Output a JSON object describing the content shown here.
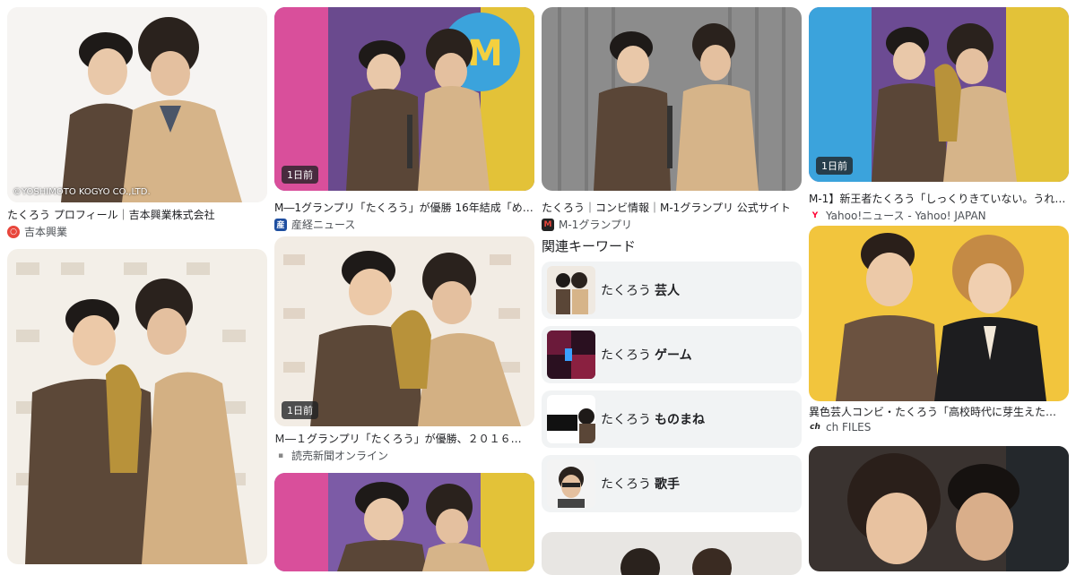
{
  "column1": {
    "card1": {
      "credit": "©YOSHIMOTO KOGYO CO.,LTD.",
      "title": "たくろう プロフィール｜吉本興業株式会社",
      "source": "吉本興業",
      "source_color": "#e8463c"
    }
  },
  "column2": {
    "card1": {
      "badge": "1日前",
      "title": "M―1グランプリ「たくろう」が優勝 16年結成「め…",
      "source": "産経ニュース",
      "source_color": "#1f4fa0"
    },
    "card2": {
      "badge": "1日前",
      "title": "Ｍ―１グランプリ「たくろう」が優勝、２０１６…",
      "source": "読売新聞オンライン",
      "source_color": "#888888"
    }
  },
  "column3": {
    "card1": {
      "title": "たくろう｜コンビ情報｜M-1グランプリ 公式サイト",
      "source": "M-1グランプリ",
      "source_color": "#c4161c"
    },
    "keywords_heading": "関連キーワード",
    "keywords": [
      {
        "prefix": "たくろう",
        "term": "芸人"
      },
      {
        "prefix": "たくろう",
        "term": "ゲーム"
      },
      {
        "prefix": "たくろう",
        "term": "ものまね"
      },
      {
        "prefix": "たくろう",
        "term": "歌手"
      }
    ]
  },
  "column4": {
    "card1": {
      "badge": "1日前",
      "title": "M-1】新王者たくろう「しっくりきていない。うれ…",
      "source": "Yahoo!ニュース - Yahoo! JAPAN",
      "source_color": "#ff0033"
    },
    "card2": {
      "title": "異色芸人コンビ・たくろう「高校時代に芽生えた…",
      "source": "ch FILES",
      "source_color": "#222222"
    }
  },
  "icons": {
    "yoshimoto": "yoshimoto-logo-icon",
    "sankei": "sankei-logo-icon",
    "yomiuri": "yomiuri-logo-icon",
    "m1": "m1-logo-icon",
    "yahoo": "yahoo-logo-icon",
    "chfiles": "chfiles-logo-icon"
  }
}
